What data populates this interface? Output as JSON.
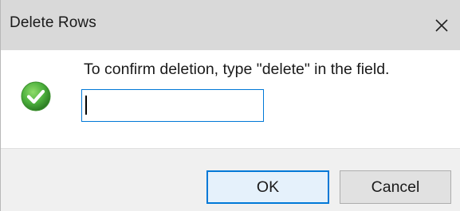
{
  "dialog": {
    "title": "Delete Rows",
    "close_icon": "close-icon",
    "message": "To confirm deletion, type \"delete\" in the field.",
    "status_icon": "check-circle-icon",
    "input": {
      "value": "",
      "placeholder": ""
    },
    "buttons": {
      "ok_label": "OK",
      "cancel_label": "Cancel"
    }
  },
  "colors": {
    "titlebar": "#d9d9d9",
    "accent": "#0078d7",
    "footer": "#f0f0f0",
    "check_green": "#4caf3c"
  }
}
